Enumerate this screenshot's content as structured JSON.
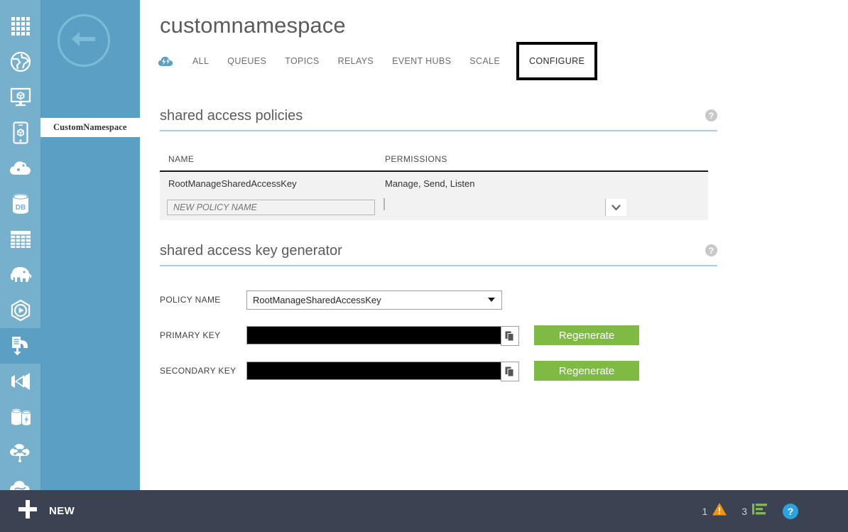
{
  "sidebar": {
    "rail_items": [
      {
        "name": "all-items-icon",
        "label": "All Items"
      },
      {
        "name": "web-sites-icon",
        "label": "Web Sites"
      },
      {
        "name": "virtual-machines-icon",
        "label": "Virtual Machines"
      },
      {
        "name": "mobile-services-icon",
        "label": "Mobile Services"
      },
      {
        "name": "cloud-services-icon",
        "label": "Cloud Services"
      },
      {
        "name": "sql-databases-icon",
        "label": "SQL Databases"
      },
      {
        "name": "storage-icon",
        "label": "Storage"
      },
      {
        "name": "hdinsight-icon",
        "label": "HDInsight"
      },
      {
        "name": "media-services-icon",
        "label": "Media Services"
      },
      {
        "name": "service-bus-icon",
        "label": "Service Bus"
      },
      {
        "name": "visual-studio-icon",
        "label": "Visual Studio Online"
      },
      {
        "name": "cache-icon",
        "label": "Cache"
      },
      {
        "name": "virtual-network-icon",
        "label": "Virtual Network"
      },
      {
        "name": "traffic-manager-icon",
        "label": "Traffic Manager"
      }
    ],
    "selected_rail_index": 9,
    "back_label": "Back",
    "selected_item": "CustomNamespace"
  },
  "header": {
    "title": "customnamespace",
    "service_icon": "service-bus-cloud-icon",
    "tabs": [
      {
        "label": "ALL",
        "active": false
      },
      {
        "label": "QUEUES",
        "active": false
      },
      {
        "label": "TOPICS",
        "active": false
      },
      {
        "label": "RELAYS",
        "active": false
      },
      {
        "label": "EVENT HUBS",
        "active": false
      },
      {
        "label": "SCALE",
        "active": false
      },
      {
        "label": "CONFIGURE",
        "active": true
      }
    ]
  },
  "shared_access_policies": {
    "section_title": "shared access policies",
    "help_glyph": "?",
    "columns": [
      "NAME",
      "PERMISSIONS"
    ],
    "rows": [
      {
        "name": "RootManageSharedAccessKey",
        "permissions": "Manage, Send, Listen"
      }
    ],
    "new_row": {
      "name_placeholder": "NEW POLICY NAME",
      "name_value": "",
      "permissions_value": ""
    }
  },
  "shared_access_key_generator": {
    "section_title": "shared access key generator",
    "help_glyph": "?",
    "policy_name_label": "POLICY NAME",
    "policy_name_value": "RootManageSharedAccessKey",
    "primary_key_label": "PRIMARY KEY",
    "primary_key_value": "",
    "primary_regenerate_label": "Regenerate",
    "secondary_key_label": "SECONDARY KEY",
    "secondary_key_value": "",
    "secondary_regenerate_label": "Regenerate",
    "copy_icon": "copy-icon"
  },
  "bottom_bar": {
    "new_label": "NEW",
    "new_icon": "plus-icon",
    "status": [
      {
        "count": "1",
        "icon": "warning-triangle-icon",
        "color": "#f5930a"
      },
      {
        "count": "3",
        "icon": "operations-list-icon",
        "color": "#7fba42"
      }
    ],
    "help_glyph": "?"
  },
  "colors": {
    "rail_blue": "#76b0cd",
    "panel_blue": "#5ba0c4",
    "accent_underline": "#a6cee3",
    "green": "#7fba42",
    "bottom_bar": "#3b4252",
    "warning_orange": "#f5930a",
    "help_blue": "#2aa3e0"
  }
}
